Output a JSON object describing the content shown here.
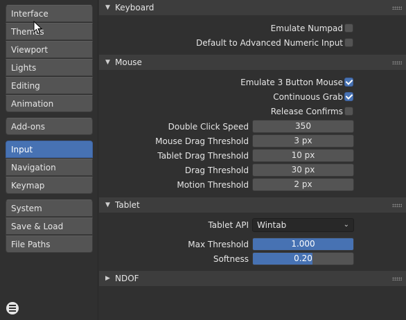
{
  "sidebar": {
    "group1": [
      "Interface",
      "Themes",
      "Viewport",
      "Lights",
      "Editing",
      "Animation"
    ],
    "group2": [
      "Add-ons"
    ],
    "group3": [
      "Input",
      "Navigation",
      "Keymap"
    ],
    "group4": [
      "System",
      "Save & Load",
      "File Paths"
    ],
    "active": "Input"
  },
  "keyboard": {
    "title": "Keyboard",
    "emulate_numpad": {
      "label": "Emulate Numpad",
      "checked": false
    },
    "default_adv_numeric": {
      "label": "Default to Advanced Numeric Input",
      "checked": false
    }
  },
  "mouse": {
    "title": "Mouse",
    "emulate_3_button": {
      "label": "Emulate 3 Button Mouse",
      "checked": true
    },
    "continuous_grab": {
      "label": "Continuous Grab",
      "checked": true
    },
    "release_confirms": {
      "label": "Release Confirms",
      "checked": false
    },
    "double_click_speed": {
      "label": "Double Click Speed",
      "value": "350"
    },
    "mouse_drag_threshold": {
      "label": "Mouse Drag Threshold",
      "value": "3 px"
    },
    "tablet_drag_threshold": {
      "label": "Tablet Drag Threshold",
      "value": "10 px"
    },
    "drag_threshold": {
      "label": "Drag Threshold",
      "value": "30 px"
    },
    "motion_threshold": {
      "label": "Motion Threshold",
      "value": "2 px"
    }
  },
  "tablet": {
    "title": "Tablet",
    "tablet_api": {
      "label": "Tablet API",
      "value": "Wintab"
    },
    "max_threshold": {
      "label": "Max Threshold",
      "value": "1.000",
      "fraction": 1.0
    },
    "softness": {
      "label": "Softness",
      "value": "0.20",
      "fraction": 0.59
    }
  },
  "ndof": {
    "title": "NDOF"
  },
  "colors": {
    "accent": "#4772b3",
    "background": "#303030",
    "panel_header": "#3d3d3d",
    "field": "#545454"
  },
  "icons": {
    "menu": "hamburger-icon",
    "expanded": "triangle-down-icon",
    "collapsed": "triangle-right-icon",
    "cursor": "mouse-pointer-icon"
  }
}
